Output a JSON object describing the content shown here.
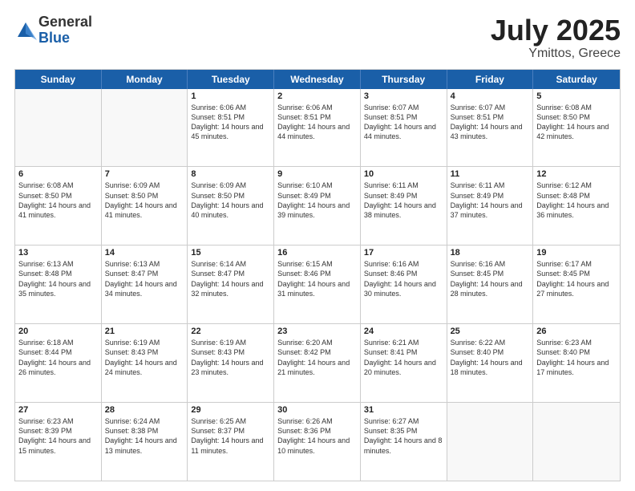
{
  "logo": {
    "general": "General",
    "blue": "Blue"
  },
  "title": "July 2025",
  "subtitle": "Ymittos, Greece",
  "header_days": [
    "Sunday",
    "Monday",
    "Tuesday",
    "Wednesday",
    "Thursday",
    "Friday",
    "Saturday"
  ],
  "weeks": [
    [
      {
        "day": "",
        "empty": true
      },
      {
        "day": "",
        "empty": true
      },
      {
        "day": "1",
        "sunrise": "6:06 AM",
        "sunset": "8:51 PM",
        "daylight": "14 hours and 45 minutes."
      },
      {
        "day": "2",
        "sunrise": "6:06 AM",
        "sunset": "8:51 PM",
        "daylight": "14 hours and 44 minutes."
      },
      {
        "day": "3",
        "sunrise": "6:07 AM",
        "sunset": "8:51 PM",
        "daylight": "14 hours and 44 minutes."
      },
      {
        "day": "4",
        "sunrise": "6:07 AM",
        "sunset": "8:51 PM",
        "daylight": "14 hours and 43 minutes."
      },
      {
        "day": "5",
        "sunrise": "6:08 AM",
        "sunset": "8:50 PM",
        "daylight": "14 hours and 42 minutes."
      }
    ],
    [
      {
        "day": "6",
        "sunrise": "6:08 AM",
        "sunset": "8:50 PM",
        "daylight": "14 hours and 41 minutes."
      },
      {
        "day": "7",
        "sunrise": "6:09 AM",
        "sunset": "8:50 PM",
        "daylight": "14 hours and 41 minutes."
      },
      {
        "day": "8",
        "sunrise": "6:09 AM",
        "sunset": "8:50 PM",
        "daylight": "14 hours and 40 minutes."
      },
      {
        "day": "9",
        "sunrise": "6:10 AM",
        "sunset": "8:49 PM",
        "daylight": "14 hours and 39 minutes."
      },
      {
        "day": "10",
        "sunrise": "6:11 AM",
        "sunset": "8:49 PM",
        "daylight": "14 hours and 38 minutes."
      },
      {
        "day": "11",
        "sunrise": "6:11 AM",
        "sunset": "8:49 PM",
        "daylight": "14 hours and 37 minutes."
      },
      {
        "day": "12",
        "sunrise": "6:12 AM",
        "sunset": "8:48 PM",
        "daylight": "14 hours and 36 minutes."
      }
    ],
    [
      {
        "day": "13",
        "sunrise": "6:13 AM",
        "sunset": "8:48 PM",
        "daylight": "14 hours and 35 minutes."
      },
      {
        "day": "14",
        "sunrise": "6:13 AM",
        "sunset": "8:47 PM",
        "daylight": "14 hours and 34 minutes."
      },
      {
        "day": "15",
        "sunrise": "6:14 AM",
        "sunset": "8:47 PM",
        "daylight": "14 hours and 32 minutes."
      },
      {
        "day": "16",
        "sunrise": "6:15 AM",
        "sunset": "8:46 PM",
        "daylight": "14 hours and 31 minutes."
      },
      {
        "day": "17",
        "sunrise": "6:16 AM",
        "sunset": "8:46 PM",
        "daylight": "14 hours and 30 minutes."
      },
      {
        "day": "18",
        "sunrise": "6:16 AM",
        "sunset": "8:45 PM",
        "daylight": "14 hours and 28 minutes."
      },
      {
        "day": "19",
        "sunrise": "6:17 AM",
        "sunset": "8:45 PM",
        "daylight": "14 hours and 27 minutes."
      }
    ],
    [
      {
        "day": "20",
        "sunrise": "6:18 AM",
        "sunset": "8:44 PM",
        "daylight": "14 hours and 26 minutes."
      },
      {
        "day": "21",
        "sunrise": "6:19 AM",
        "sunset": "8:43 PM",
        "daylight": "14 hours and 24 minutes."
      },
      {
        "day": "22",
        "sunrise": "6:19 AM",
        "sunset": "8:43 PM",
        "daylight": "14 hours and 23 minutes."
      },
      {
        "day": "23",
        "sunrise": "6:20 AM",
        "sunset": "8:42 PM",
        "daylight": "14 hours and 21 minutes."
      },
      {
        "day": "24",
        "sunrise": "6:21 AM",
        "sunset": "8:41 PM",
        "daylight": "14 hours and 20 minutes."
      },
      {
        "day": "25",
        "sunrise": "6:22 AM",
        "sunset": "8:40 PM",
        "daylight": "14 hours and 18 minutes."
      },
      {
        "day": "26",
        "sunrise": "6:23 AM",
        "sunset": "8:40 PM",
        "daylight": "14 hours and 17 minutes."
      }
    ],
    [
      {
        "day": "27",
        "sunrise": "6:23 AM",
        "sunset": "8:39 PM",
        "daylight": "14 hours and 15 minutes."
      },
      {
        "day": "28",
        "sunrise": "6:24 AM",
        "sunset": "8:38 PM",
        "daylight": "14 hours and 13 minutes."
      },
      {
        "day": "29",
        "sunrise": "6:25 AM",
        "sunset": "8:37 PM",
        "daylight": "14 hours and 11 minutes."
      },
      {
        "day": "30",
        "sunrise": "6:26 AM",
        "sunset": "8:36 PM",
        "daylight": "14 hours and 10 minutes."
      },
      {
        "day": "31",
        "sunrise": "6:27 AM",
        "sunset": "8:35 PM",
        "daylight": "14 hours and 8 minutes."
      },
      {
        "day": "",
        "empty": true
      },
      {
        "day": "",
        "empty": true
      }
    ]
  ]
}
